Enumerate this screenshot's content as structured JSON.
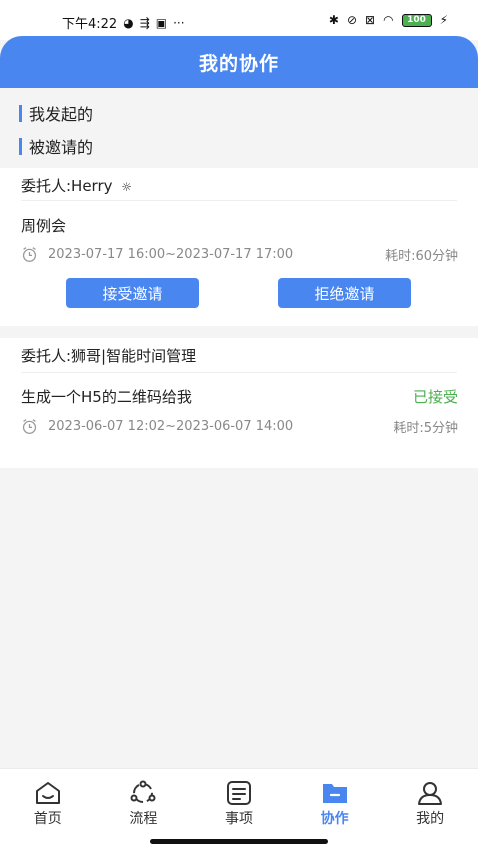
{
  "status_bar": {
    "time": "下午4:22",
    "battery": "100"
  },
  "header": {
    "title": "我的协作"
  },
  "sections": {
    "initiated": "我发起的",
    "invited": "被邀请的"
  },
  "cards": [
    {
      "delegator": "委托人:Herry",
      "title": "周例会",
      "time_range": "2023-07-17 16:00~2023-07-17 17:00",
      "duration": "耗时:60分钟",
      "accept_label": "接受邀请",
      "reject_label": "拒绝邀请"
    },
    {
      "delegator": "委托人:狮哥|智能时间管理",
      "title": "生成一个H5的二维码给我",
      "status": "已接受",
      "time_range": "2023-06-07 12:02~2023-06-07 14:00",
      "duration": "耗时:5分钟"
    }
  ],
  "tabbar": {
    "items": [
      {
        "label": "首页",
        "icon": "home-icon"
      },
      {
        "label": "流程",
        "icon": "flow-icon"
      },
      {
        "label": "事项",
        "icon": "list-icon"
      },
      {
        "label": "协作",
        "icon": "folder-icon",
        "active": true
      },
      {
        "label": "我的",
        "icon": "user-icon"
      }
    ]
  },
  "colors": {
    "accent": "#4a86f0",
    "accepted": "#4caf50",
    "muted": "#888888"
  }
}
